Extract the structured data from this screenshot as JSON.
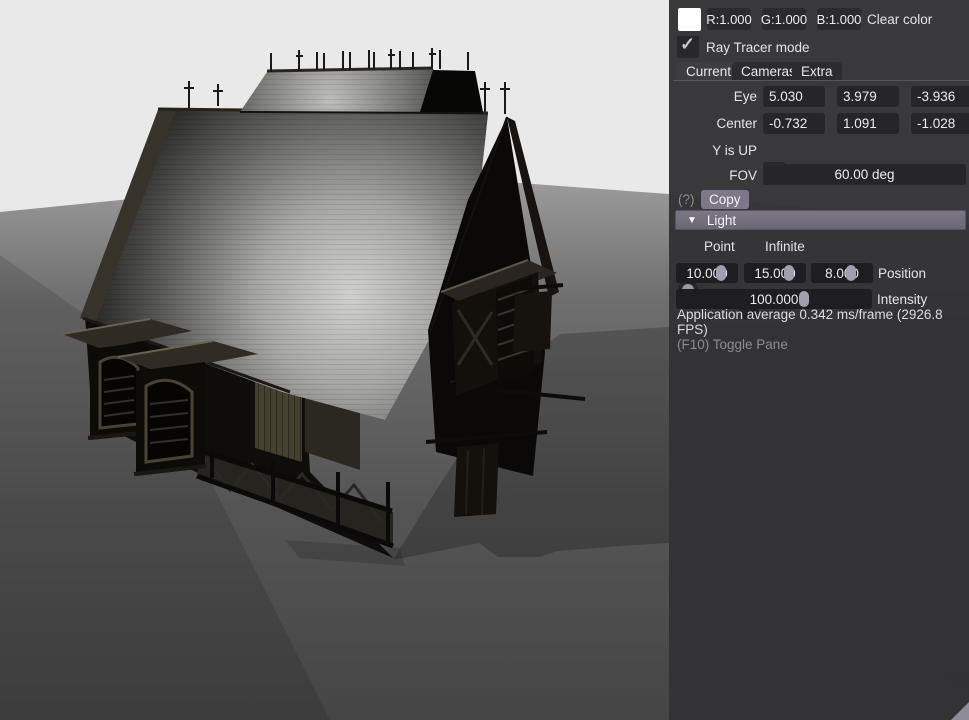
{
  "panel": {
    "color_row": {
      "swatch_color": "#ffffff",
      "r": "R:1.000",
      "g": "G:1.000",
      "b": "B:1.000",
      "label": "Clear color"
    },
    "ray_tracer": {
      "label": "Ray Tracer mode",
      "checked": true
    },
    "tabs": [
      {
        "label": "Current",
        "active": true
      },
      {
        "label": "Cameras",
        "active": false
      },
      {
        "label": "Extra",
        "active": false
      }
    ],
    "camera": {
      "eye_label": "Eye",
      "eye": [
        "5.030",
        "3.979",
        "-3.936"
      ],
      "center_label": "Center",
      "center": [
        "-0.732",
        "1.091",
        "-1.028"
      ],
      "y_up_label": "Y is UP",
      "y_up_checked": true,
      "fov_label": "FOV",
      "fov": "60.00 deg"
    },
    "copy_row": {
      "hint": "(?)",
      "button": "Copy"
    },
    "light": {
      "header": "Light",
      "modes": [
        {
          "label": "Point",
          "selected": true
        },
        {
          "label": "Infinite",
          "selected": false
        }
      ],
      "position": {
        "values": [
          "10.000",
          "15.000",
          "8.000"
        ],
        "label": "Position"
      },
      "intensity": {
        "value": "100.000",
        "label": "Intensity"
      }
    },
    "stats": "Application average 0.342 ms/frame (2926.8 FPS)",
    "toggle_hint": "(F10) Toggle Pane"
  },
  "icons": {
    "check": "✓",
    "collapse": "▼"
  },
  "colors": {
    "accent": "#7d7889",
    "slider_grab": "#a39db0",
    "frame_bg": "#26262a",
    "header_bg": "#716d7c",
    "panel_bg": "#343437",
    "sky": "#e9e9e9",
    "panel_text": "#e4e4e4",
    "muted_text": "#8d8d8d"
  }
}
